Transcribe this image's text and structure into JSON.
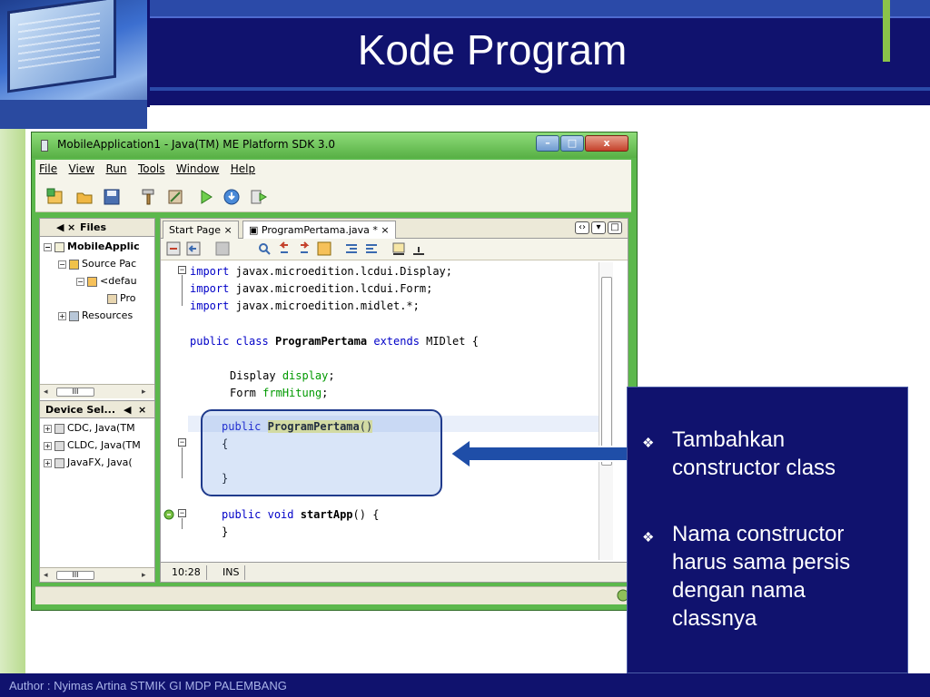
{
  "slide": {
    "title": "Kode Program",
    "footer": "Author : Nyimas Artina   STMIK GI MDP PALEMBANG",
    "accent_color": "#10126e",
    "band_color": "#2b4aa8"
  },
  "window": {
    "title": "MobileApplication1 - Java(TM) ME Platform SDK 3.0",
    "menu": [
      "File",
      "View",
      "Run",
      "Tools",
      "Window",
      "Help"
    ]
  },
  "left_panel": {
    "tab_projects_glyph": "◀",
    "tab_files": "Files",
    "tree": [
      "MobileApplic",
      "Source Pac",
      "<defau",
      "Pro",
      "Resources"
    ],
    "device_tab": "Device Sel...",
    "devices": [
      "CDC, Java(TM",
      "CLDC, Java(TM",
      "JavaFX, Java("
    ]
  },
  "editor": {
    "tabs": [
      "Start Page",
      "ProgramPertama.java *"
    ],
    "status": {
      "position": "10:28",
      "mode": "INS"
    }
  },
  "code": {
    "import1": "javax.microedition.lcdui.Display;",
    "import2": "javax.microedition.lcdui.Form;",
    "import3": "javax.microedition.midlet.*;",
    "kw_import": "import",
    "kw_public": "public",
    "kw_class": "class",
    "kw_extends": "extends",
    "kw_void": "void",
    "class_name": "ProgramPertama",
    "super_class": "MIDlet {",
    "type_display": "Display",
    "field_display": "display",
    "type_form": "Form",
    "field_form": "frmHitung",
    "constructor": "ProgramPertama",
    "paren": "()",
    "open_brace": "{",
    "close_brace": "}",
    "method": "startApp",
    "method_tail": "() {",
    "semicolon": ";"
  },
  "info": {
    "bullets": [
      "Tambahkan constructor class",
      "Nama constructor harus sama persis dengan nama classnya"
    ]
  }
}
